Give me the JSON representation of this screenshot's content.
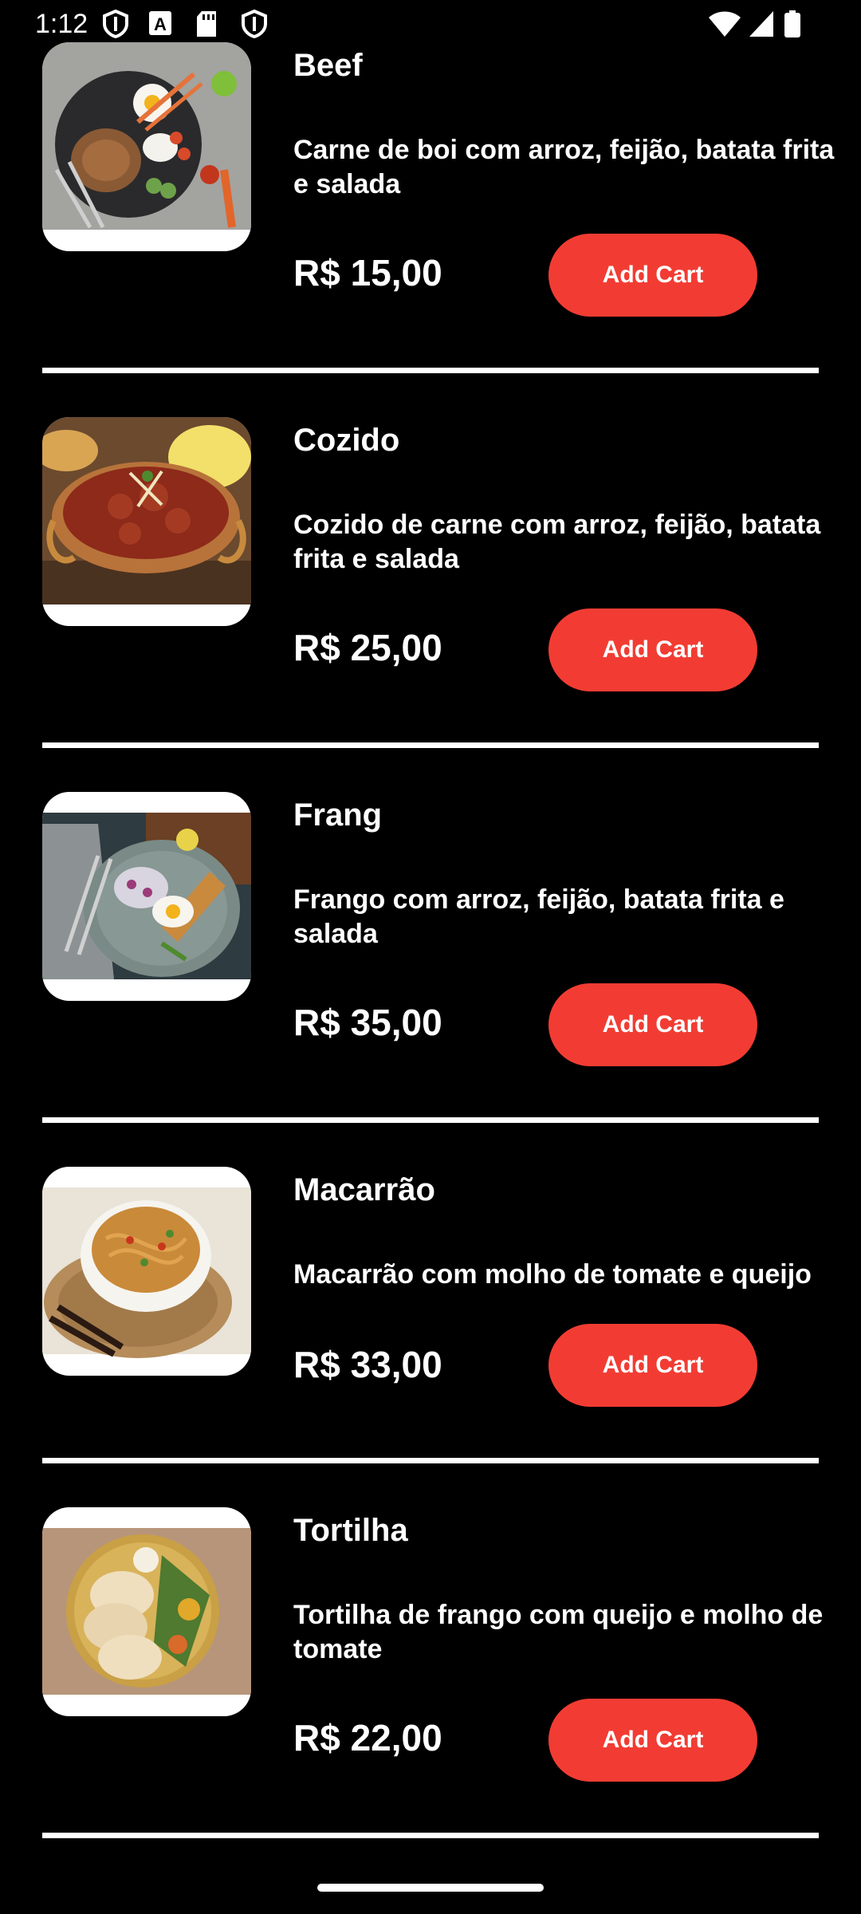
{
  "status_bar": {
    "time": "1:12",
    "icons": [
      "shield-icon",
      "text-a-icon",
      "sd-card-icon",
      "shield-icon",
      "wifi-icon",
      "cellular-signal-icon",
      "battery-icon"
    ]
  },
  "menu": {
    "items": [
      {
        "name": "Beef",
        "description": "Carne de boi com arroz, feijão, batata frita e salada",
        "price": "R$ 15,00",
        "button_label": "Add Cart",
        "image": "steak-plate-image"
      },
      {
        "name": "Cozido",
        "description": "Cozido de carne com arroz, feijão, batata frita e salada",
        "price": "R$ 25,00",
        "button_label": "Add Cart",
        "image": "stew-bowl-image"
      },
      {
        "name": "Frang",
        "description": "Frango com arroz, feijão, batata frita e salada",
        "price": "R$ 35,00",
        "button_label": "Add Cart",
        "image": "chicken-plate-image"
      },
      {
        "name": "Macarrão",
        "description": "Macarrão com molho de tomate e queijo",
        "price": "R$ 33,00",
        "button_label": "Add Cart",
        "image": "noodles-bowl-image"
      },
      {
        "name": "Tortilha",
        "description": "Tortilha de frango com queijo e molho de tomate",
        "price": "R$ 22,00",
        "button_label": "Add Cart",
        "image": "tortilla-plate-image"
      }
    ]
  },
  "colors": {
    "background": "#000000",
    "accent": "#f23c33",
    "text": "#ffffff"
  }
}
